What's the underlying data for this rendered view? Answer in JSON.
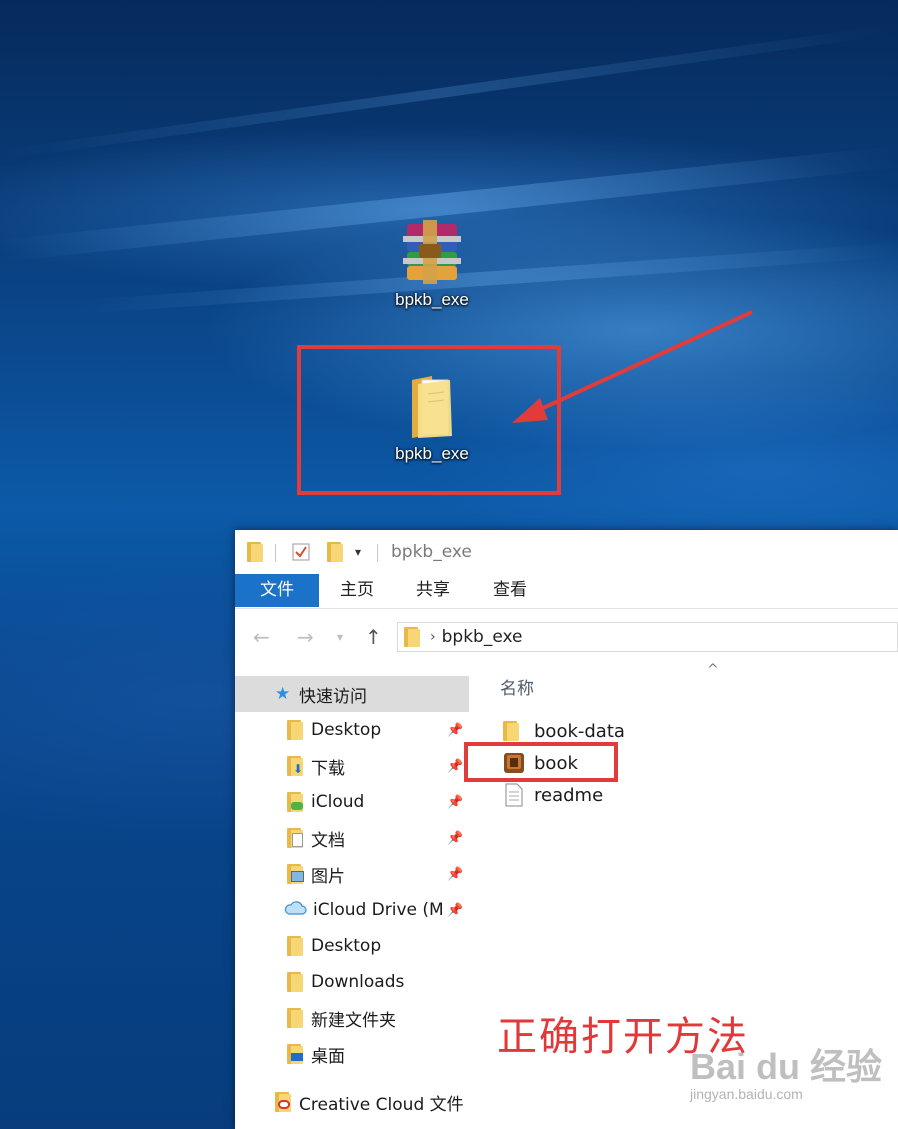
{
  "desktop": {
    "icons": [
      {
        "label": "bpkb_exe",
        "icon": "winrar-archive-icon"
      },
      {
        "label": "bpkb_exe",
        "icon": "folder-icon"
      }
    ]
  },
  "explorer": {
    "window_title": "bpkb_exe",
    "ribbon_tabs": [
      "文件",
      "主页",
      "共享",
      "查看"
    ],
    "address_path": "bpkb_exe",
    "column_header": "名称",
    "nav_items": [
      {
        "label": "快速访问",
        "icon": "star-icon",
        "pinned": false
      },
      {
        "label": "Desktop",
        "icon": "folder-icon",
        "pinned": true
      },
      {
        "label": "下载",
        "icon": "download-folder-icon",
        "pinned": true
      },
      {
        "label": "iCloud",
        "icon": "icloud-folder-icon",
        "pinned": true
      },
      {
        "label": "文档",
        "icon": "documents-folder-icon",
        "pinned": true
      },
      {
        "label": "图片",
        "icon": "pictures-folder-icon",
        "pinned": true
      },
      {
        "label": "iCloud Drive (M",
        "icon": "cloud-icon",
        "pinned": true
      },
      {
        "label": "Desktop",
        "icon": "folder-icon",
        "pinned": false
      },
      {
        "label": "Downloads",
        "icon": "folder-icon",
        "pinned": false
      },
      {
        "label": "新建文件夹",
        "icon": "folder-icon",
        "pinned": false
      },
      {
        "label": "桌面",
        "icon": "desktop-folder-icon",
        "pinned": false
      },
      {
        "label": "Creative Cloud 文件",
        "icon": "creative-cloud-icon",
        "pinned": false
      }
    ],
    "files": [
      {
        "name": "book-data",
        "icon": "folder-icon"
      },
      {
        "name": "book",
        "icon": "book-app-icon"
      },
      {
        "name": "readme",
        "icon": "text-file-icon"
      }
    ]
  },
  "annotation": {
    "caption": "正确打开方法",
    "color": "#e23b3b"
  },
  "watermark": {
    "brand": "Bai du 经验",
    "url": "jingyan.baidu.com"
  }
}
